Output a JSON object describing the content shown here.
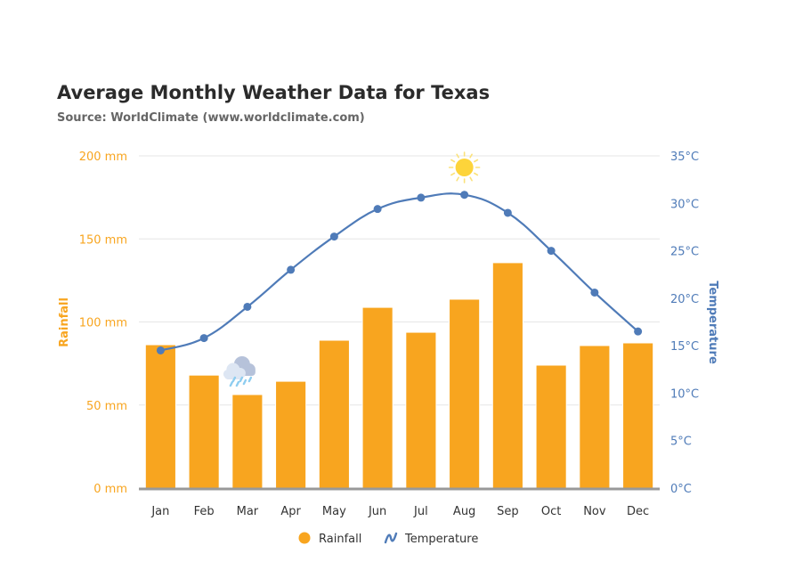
{
  "chart_data": {
    "type": "bar",
    "title": "Average Monthly Weather Data for Texas",
    "subtitle": "Source: WorldClimate (www.worldclimate.com)",
    "categories": [
      "Jan",
      "Feb",
      "Mar",
      "Apr",
      "May",
      "Jun",
      "Jul",
      "Aug",
      "Sep",
      "Oct",
      "Nov",
      "Dec"
    ],
    "series": [
      {
        "name": "Rainfall",
        "type": "bar",
        "axis": "left",
        "unit": "mm",
        "color": "#f8a51f",
        "values": [
          86.3,
          68.0,
          56.3,
          64.3,
          89.0,
          108.8,
          93.8,
          113.7,
          135.7,
          74.0,
          85.8,
          87.4
        ]
      },
      {
        "name": "Temperature",
        "type": "line",
        "axis": "right",
        "unit": "°C",
        "color": "#4f7bb8",
        "values": [
          14.5,
          15.8,
          19.1,
          23.0,
          26.5,
          29.4,
          30.6,
          30.9,
          29.0,
          25.0,
          20.6,
          16.5
        ]
      }
    ],
    "y_left": {
      "label": "Rainfall",
      "range": [
        0,
        200
      ],
      "ticks": [
        0,
        50,
        100,
        150,
        200
      ],
      "tick_labels": [
        "0 mm",
        "50 mm",
        "100 mm",
        "150 mm",
        "200 mm"
      ]
    },
    "y_right": {
      "label": "Temperature",
      "range": [
        0,
        35
      ],
      "ticks": [
        0,
        5,
        10,
        15,
        20,
        25,
        30,
        35
      ],
      "tick_labels": [
        "0°C",
        "5°C",
        "10°C",
        "15°C",
        "20°C",
        "25°C",
        "30°C",
        "35°C"
      ]
    },
    "xlabel": "",
    "grid": true,
    "legend": {
      "position": "bottom-center",
      "items": [
        {
          "label": "Rainfall",
          "symbol": "circle",
          "color": "#f8a51f"
        },
        {
          "label": "Temperature",
          "symbol": "line",
          "color": "#4f7bb8"
        }
      ]
    },
    "annotations": [
      {
        "type": "icon",
        "icon": "rain-cloud-icon",
        "category": "Mar"
      },
      {
        "type": "icon",
        "icon": "sun-icon",
        "category": "Aug"
      }
    ]
  }
}
